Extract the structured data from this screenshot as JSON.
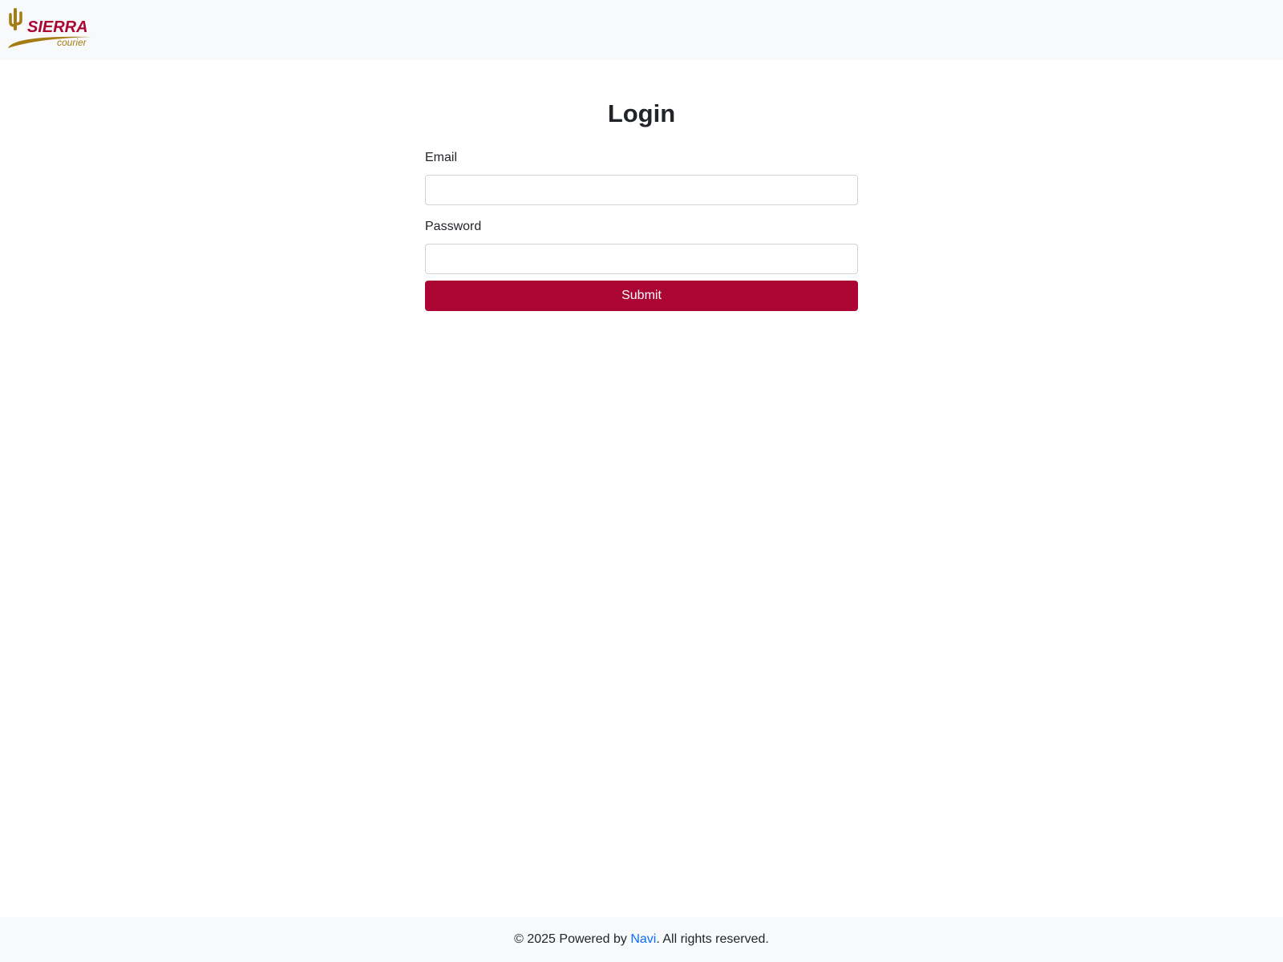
{
  "header": {
    "logo": {
      "brand": "SIERRA",
      "sub": "courier",
      "colors": {
        "brand": "#ab0534",
        "accent": "#a57c14"
      }
    }
  },
  "form": {
    "title": "Login",
    "email_label": "Email",
    "email_value": "",
    "password_label": "Password",
    "password_value": "",
    "submit_label": "Submit"
  },
  "footer": {
    "prefix": "© 2025 Powered by ",
    "link_text": "Navi",
    "suffix": ". All rights reserved."
  },
  "colors": {
    "primary": "#ab0534",
    "link": "#0d6efd",
    "bar_background": "#f8f9fa",
    "text": "#212529"
  }
}
